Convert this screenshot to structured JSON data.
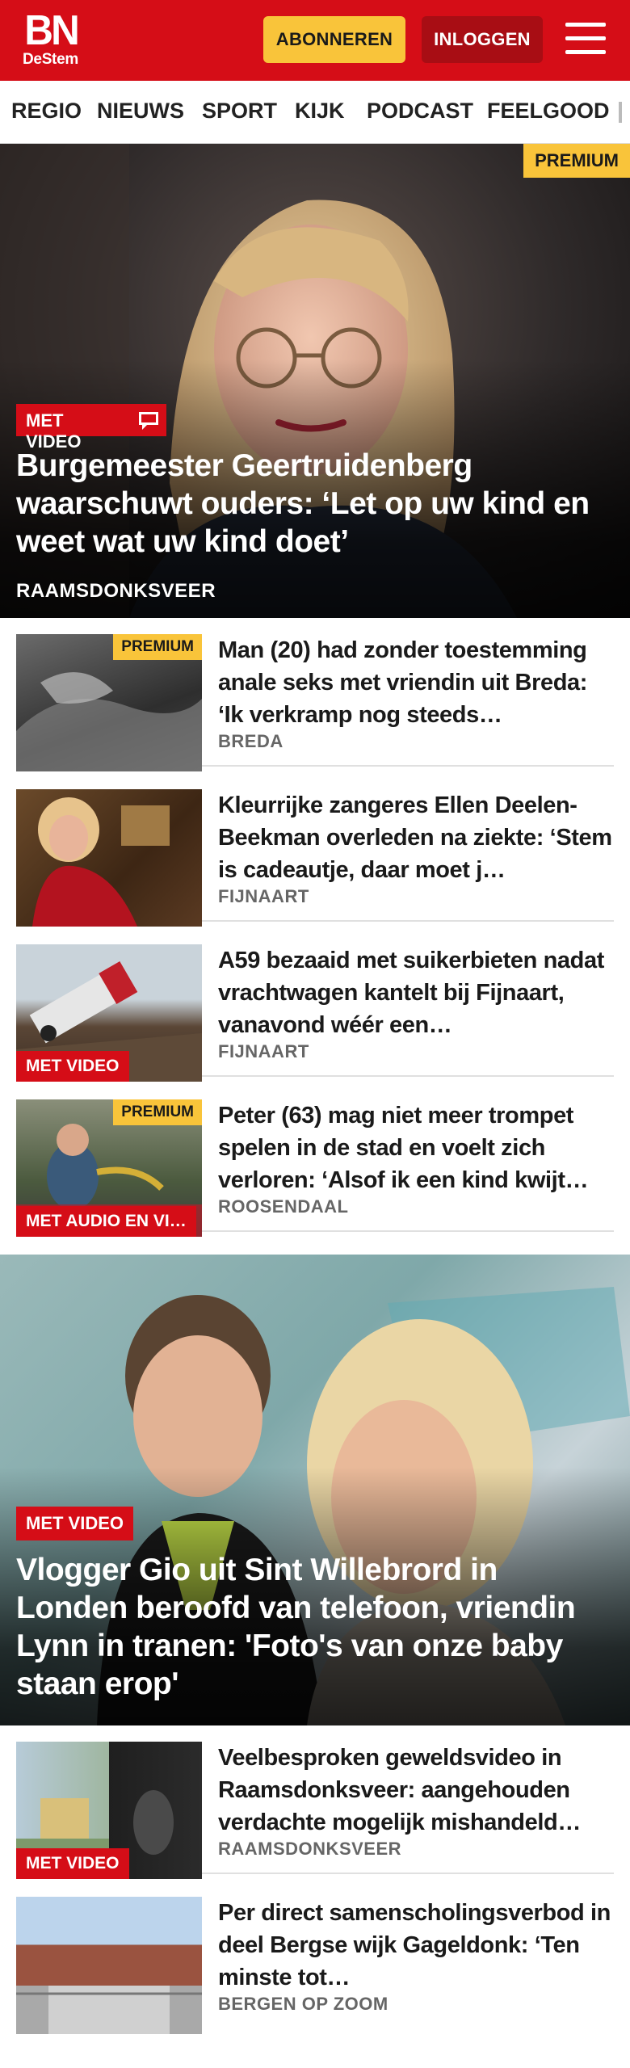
{
  "header": {
    "logo_main": "BN",
    "logo_sub": "DeStem",
    "subscribe_label": "ABONNEREN",
    "login_label": "INLOGGEN",
    "menu_icon": "hamburger-menu-icon",
    "brand_color": "#d50d17",
    "subscribe_color": "#f9c43a"
  },
  "nav": {
    "items": [
      "REGIO",
      "NIEUWS",
      "SPORT",
      "KIJK",
      "PODCAST",
      "FEELGOOD"
    ]
  },
  "hero1": {
    "premium": "PREMIUM",
    "tag": "MET VIDEO",
    "comment_icon": "comment-icon",
    "title": "Burgemeester Geertruidenberg waarschuwt ouders: ‘Let op uw kind en weet wat uw kind doet’",
    "location": "RAAMSDONKSVEER"
  },
  "articles1": [
    {
      "premium": "PREMIUM",
      "tag": "",
      "title": "Man (20) had zonder toestem­ming anale seks met vriendin uit Breda: ‘Ik verkramp nog steeds…",
      "location": "BREDA"
    },
    {
      "premium": "",
      "tag": "",
      "title": "Kleurrijke zangeres Ellen Deelen-Beekman overleden na ziekte: ‘Stem is cadeautje, daar moet j…",
      "location": "FIJNAART"
    },
    {
      "premium": "",
      "tag": "MET VIDEO",
      "title": "A59 bezaaid met suikerbieten nadat vrachtwagen kantelt bij Fijnaart, vanavond wéér een…",
      "location": "FIJNAART"
    },
    {
      "premium": "PREMIUM",
      "tag": "MET AUDIO EN VI…",
      "title": "Peter (63) mag niet meer trompet spelen in de stad en voelt zich verloren: ‘Alsof ik een kind kwijt…",
      "location": "ROOSENDAAL"
    }
  ],
  "hero2": {
    "tag": "MET VIDEO",
    "title": "Vlogger Gio uit Sint Willebrord in Londen beroofd van telefoon, vriendin Lynn in tranen: 'Foto's van onze baby staan erop'"
  },
  "articles2": [
    {
      "tag": "MET VIDEO",
      "title": "Veelbesproken geweldsvideo in Raamsdonksveer: aangehouden verdachte mogelijk mishandeld…",
      "location": "RAAMSDONKSVEER"
    },
    {
      "tag": "",
      "title": "Per direct samenscholingsver­bod in deel Bergse wijk Gageldonk: ‘Ten minste tot…",
      "location": "BERGEN OP ZOOM"
    }
  ]
}
